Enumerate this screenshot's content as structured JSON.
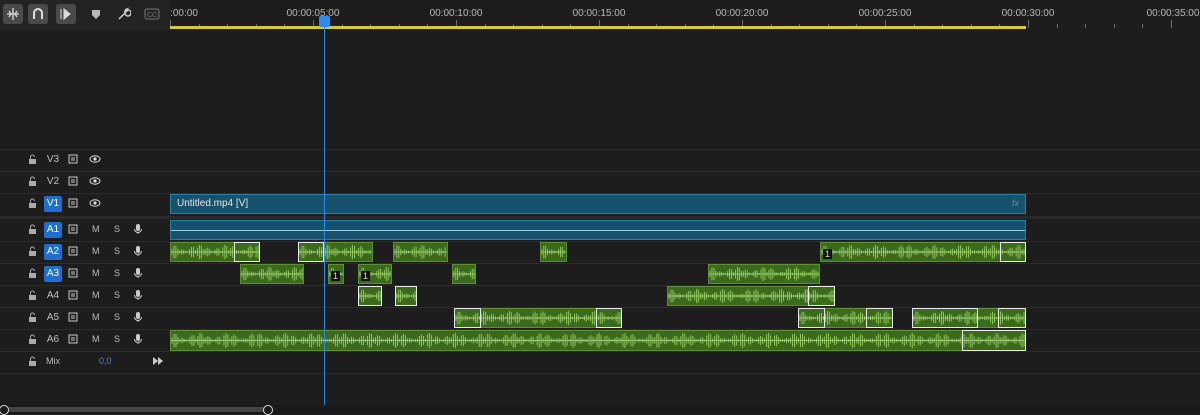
{
  "toolbar": {
    "icons": [
      "snap-in-timeline-icon",
      "linked-selection-icon",
      "ripple-edit-icon",
      "add-marker-icon",
      "timeline-settings-icon",
      "captions-icon"
    ]
  },
  "ruler": {
    "timecodes": [
      ":00:00",
      "00:00:05:00",
      "00:00:10:00",
      "00:00:15:00",
      "00:00:20:00",
      "00:00:25:00",
      "00:00:30:00",
      "00:00:35:00"
    ]
  },
  "tracks": {
    "video": [
      {
        "name": "V3",
        "targeted": false
      },
      {
        "name": "V2",
        "targeted": false
      },
      {
        "name": "V1",
        "targeted": true
      }
    ],
    "audio": [
      {
        "name": "A1",
        "targeted": true,
        "mute": "M",
        "solo": "S"
      },
      {
        "name": "A2",
        "targeted": true,
        "mute": "M",
        "solo": "S"
      },
      {
        "name": "A3",
        "targeted": true,
        "mute": "M",
        "solo": "S"
      },
      {
        "name": "A4",
        "targeted": false,
        "mute": "M",
        "solo": "S"
      },
      {
        "name": "A5",
        "targeted": false,
        "mute": "M",
        "solo": "S"
      },
      {
        "name": "A6",
        "targeted": false,
        "mute": "M",
        "solo": "S"
      }
    ],
    "mix": {
      "label": "Mix",
      "value": "0,0"
    }
  },
  "video_clip": {
    "name": "Untitled.mp4 [V]",
    "fx": "fx"
  },
  "keyframe_labels": {
    "a2": "1",
    "a3a": "1",
    "a3b": "1"
  },
  "colors": {
    "playhead": "#2d8ceb",
    "audio_clip": "#3b6a1d",
    "video_clip": "#16516e",
    "work_area": "#d8c93a",
    "target": "#1f6fd0"
  }
}
